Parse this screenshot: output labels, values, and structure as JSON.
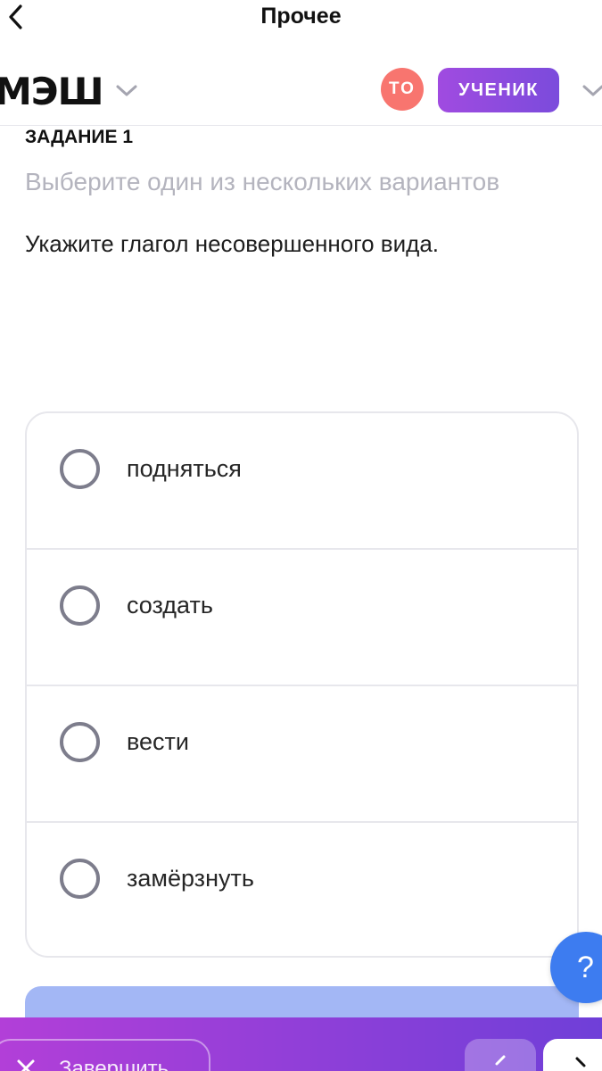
{
  "navbar": {
    "title": "Прочее"
  },
  "header": {
    "logo": "МЭШ",
    "avatar_initials": "ТО",
    "role": "УЧЕНИК"
  },
  "task": {
    "label": "ЗАДАНИЕ 1",
    "hint": "Выберите один из нескольких вариантов",
    "question": "Укажите глагол несовершенного вида."
  },
  "options": [
    {
      "label": "подняться"
    },
    {
      "label": "создать"
    },
    {
      "label": "вести"
    },
    {
      "label": "замёрзнуть"
    }
  ],
  "help": {
    "label": "?"
  },
  "bottom": {
    "finish_label": "Завершить"
  }
}
